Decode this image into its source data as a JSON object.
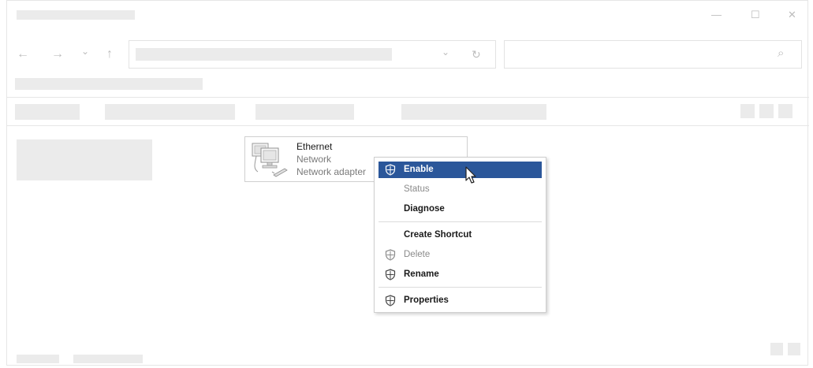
{
  "window": {
    "controls": {
      "minimize": "—",
      "maximize": "☐",
      "close": "✕"
    }
  },
  "nav": {
    "back_icon": "←",
    "forward_icon": "→",
    "recent_icon": "⌄",
    "up_icon": "↑",
    "address_dropdown_icon": "⌄",
    "refresh_icon": "↻",
    "search_icon": "⌕"
  },
  "item": {
    "name": "Ethernet",
    "type": "Network",
    "device": "Network adapter"
  },
  "context_menu": {
    "items": [
      {
        "label": "Enable",
        "icon": "shield-icon",
        "state": "highlighted"
      },
      {
        "label": "Status",
        "icon": "",
        "state": "disabled"
      },
      {
        "label": "Diagnose",
        "icon": "",
        "state": "normal"
      },
      {
        "label": "Create Shortcut",
        "icon": "",
        "state": "normal"
      },
      {
        "label": "Delete",
        "icon": "shield-icon",
        "state": "disabled"
      },
      {
        "label": "Rename",
        "icon": "shield-icon",
        "state": "normal"
      },
      {
        "label": "Properties",
        "icon": "shield-icon",
        "state": "normal"
      }
    ]
  },
  "colors": {
    "highlight": "#2b579a",
    "disabled_text": "#8a8a8a",
    "placeholder": "#ebebeb"
  }
}
